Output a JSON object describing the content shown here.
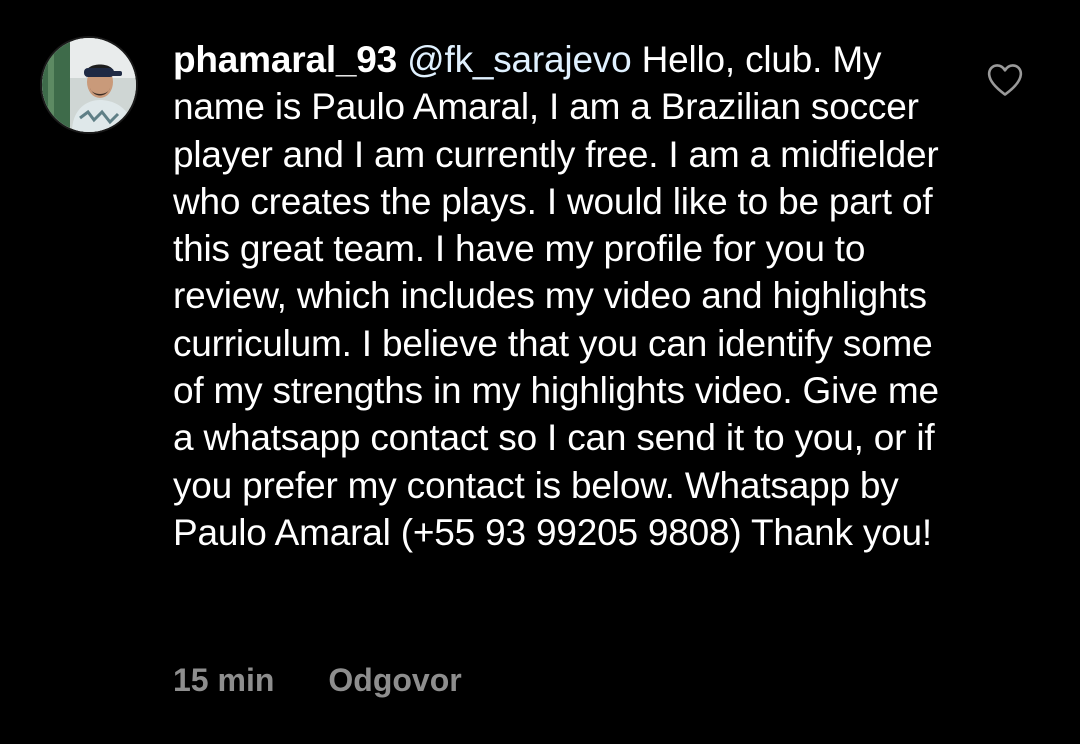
{
  "comment": {
    "username": "phamaral_93",
    "mention": "@fk_sarajevo",
    "text": "Hello, club.  My name is Paulo Amaral, I am a Brazilian soccer player and I am currently free.  I am a midfielder who creates the plays.  I would like to be part of this great team.  I have my profile for you to review, which includes my video and highlights curriculum.  I believe that you can identify some of my strengths in my highlights video.  Give me a whatsapp contact so I can send it to you, or if you prefer my contact is below.  Whatsapp by Paulo Amaral (+55 93 99205 9808) Thank you!",
    "timestamp": "15 min",
    "reply_label": "Odgovor"
  },
  "icons": {
    "like": "heart-outline-icon",
    "avatar": "user-avatar"
  },
  "colors": {
    "background": "#000000",
    "text": "#ffffff",
    "mention": "#e0f1ff",
    "meta": "#8e8e8e"
  }
}
